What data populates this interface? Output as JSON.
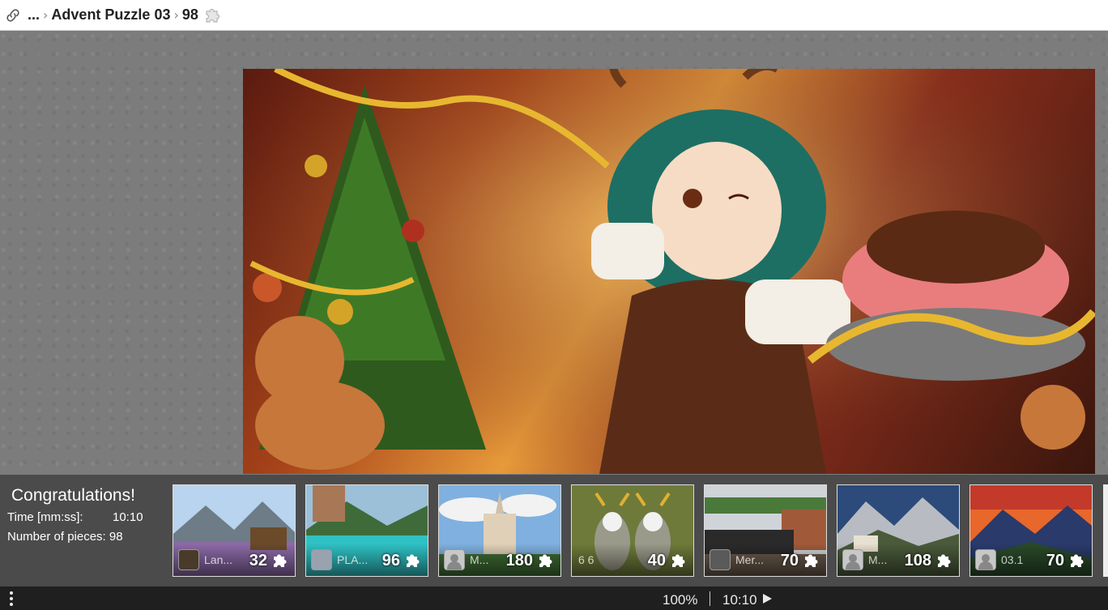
{
  "breadcrumb": {
    "ellipsis": "...",
    "title": "Advent Puzzle 03",
    "pieces": "98"
  },
  "congrats": {
    "title": "Congratulations!",
    "time_label": "Time [mm:ss]:",
    "time_value": "10:10",
    "pieces_label": "Number of pieces: 98"
  },
  "thumbnails": [
    {
      "name": "Lan...",
      "count": "32"
    },
    {
      "name": "PLA...",
      "count": "96"
    },
    {
      "name": "M...",
      "count": "180"
    },
    {
      "name": "6 6",
      "count": "40"
    },
    {
      "name": "Mer...",
      "count": "70"
    },
    {
      "name": "M...",
      "count": "108"
    },
    {
      "name": "03.1",
      "count": "70"
    }
  ],
  "status": {
    "zoom": "100%",
    "timer": "10:10"
  }
}
